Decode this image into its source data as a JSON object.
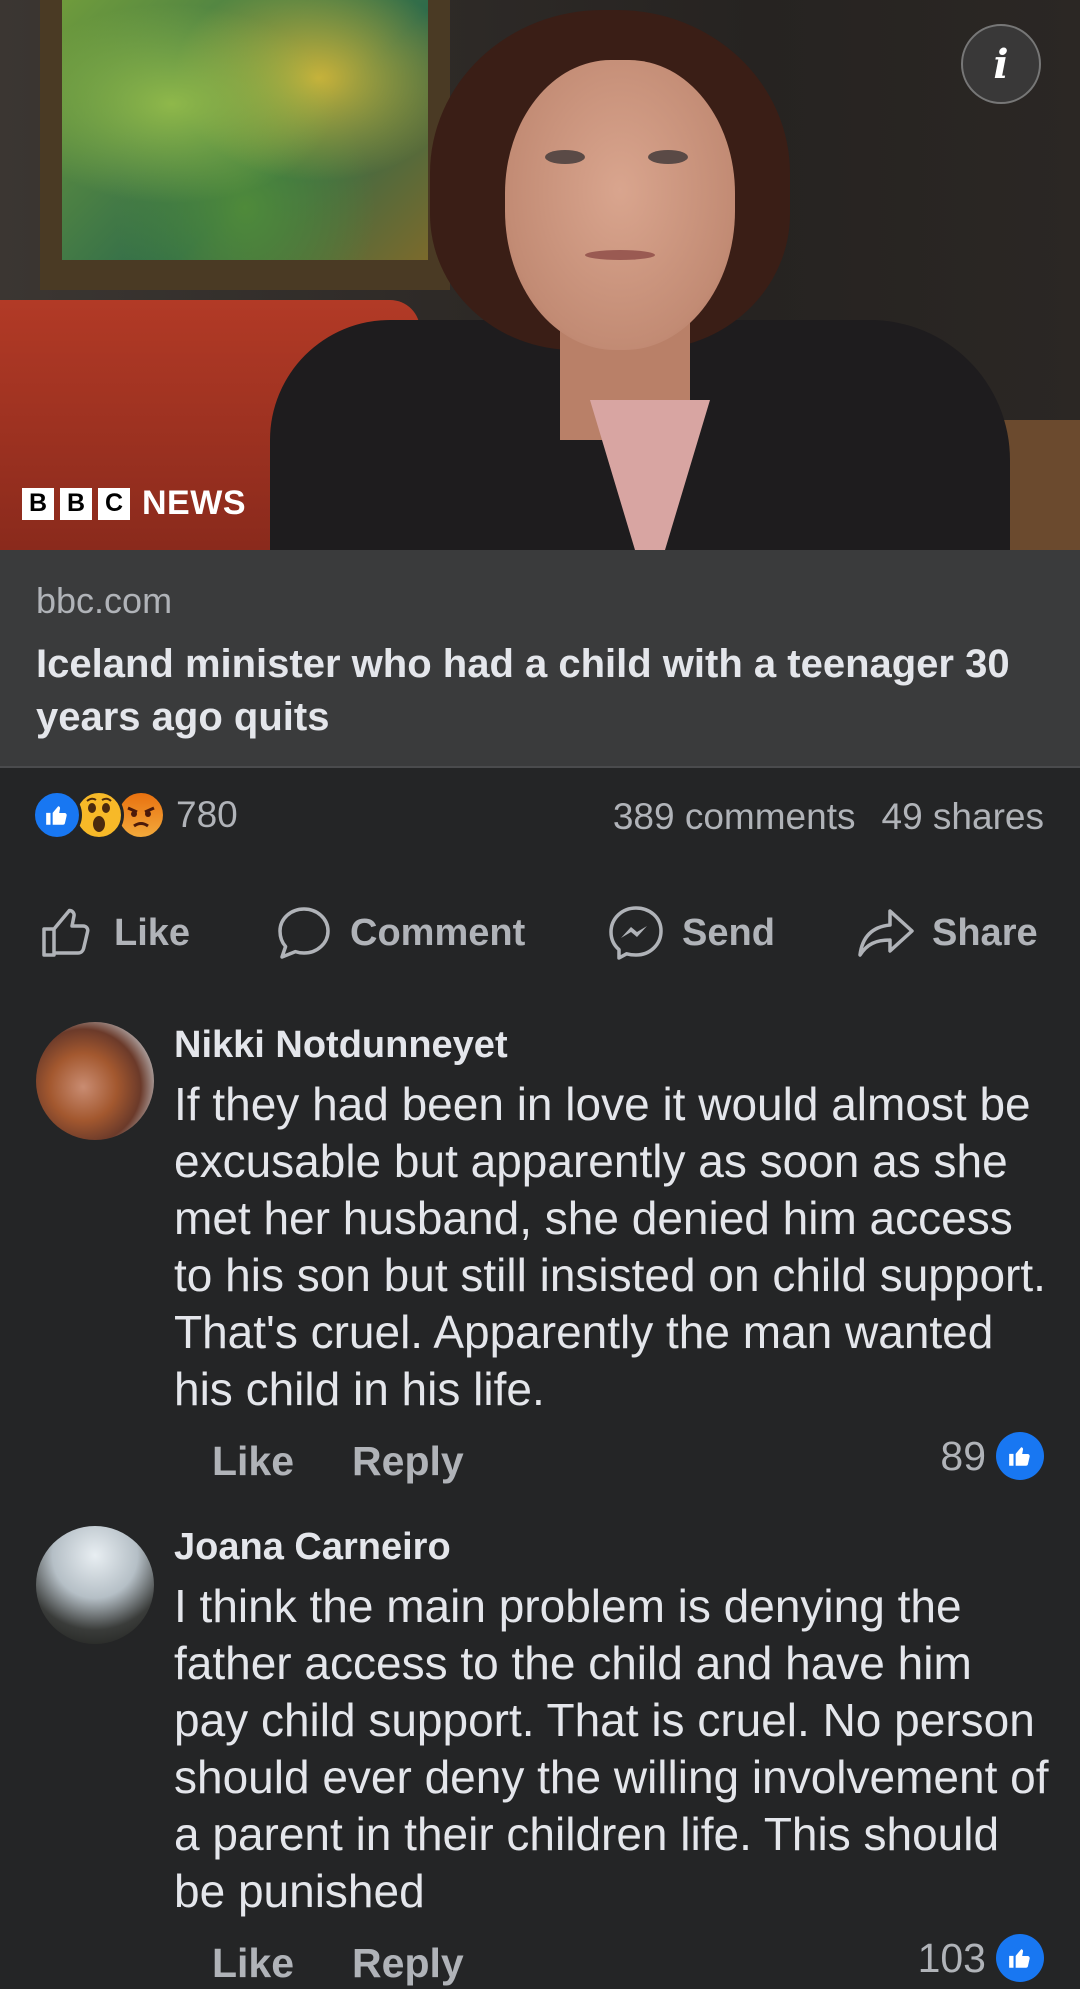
{
  "preview": {
    "brand_label": "NEWS",
    "brand_letters": [
      "B",
      "B",
      "C"
    ],
    "info_icon": "info-icon",
    "domain": "bbc.com",
    "headline": "Iceland minister who had a child with a teenager 30 years ago quits"
  },
  "summary": {
    "reaction_icons": [
      "like-reaction-icon",
      "wow-reaction-icon",
      "angry-reaction-icon"
    ],
    "reaction_count": "780",
    "comments": "389 comments",
    "shares": "49 shares"
  },
  "actions": {
    "like": "Like",
    "comment": "Comment",
    "send": "Send",
    "share": "Share"
  },
  "comments": [
    {
      "author": "Nikki Notdunneyet",
      "text": "If they had been in love it would almost be excusable but apparently as soon as she met her husband, she denied him access to his son but still insisted on child support. That's cruel. Apparently the man wanted his child in his life.",
      "like_label": "Like",
      "reply_label": "Reply",
      "likes": "89"
    },
    {
      "author": "Joana Carneiro",
      "text": "I think the main problem is denying the father access to the child and have him pay child support. That is cruel. No person should ever deny the willing involvement of a parent in their children life. This should be punished",
      "like_label": "Like",
      "reply_label": "Reply",
      "likes": "103"
    }
  ],
  "colors": {
    "background": "#242526",
    "link_box": "#3a3b3c",
    "secondary_text": "#b0b3b8",
    "primary_text": "#e4e6eb",
    "like_blue": "#1877f2"
  }
}
